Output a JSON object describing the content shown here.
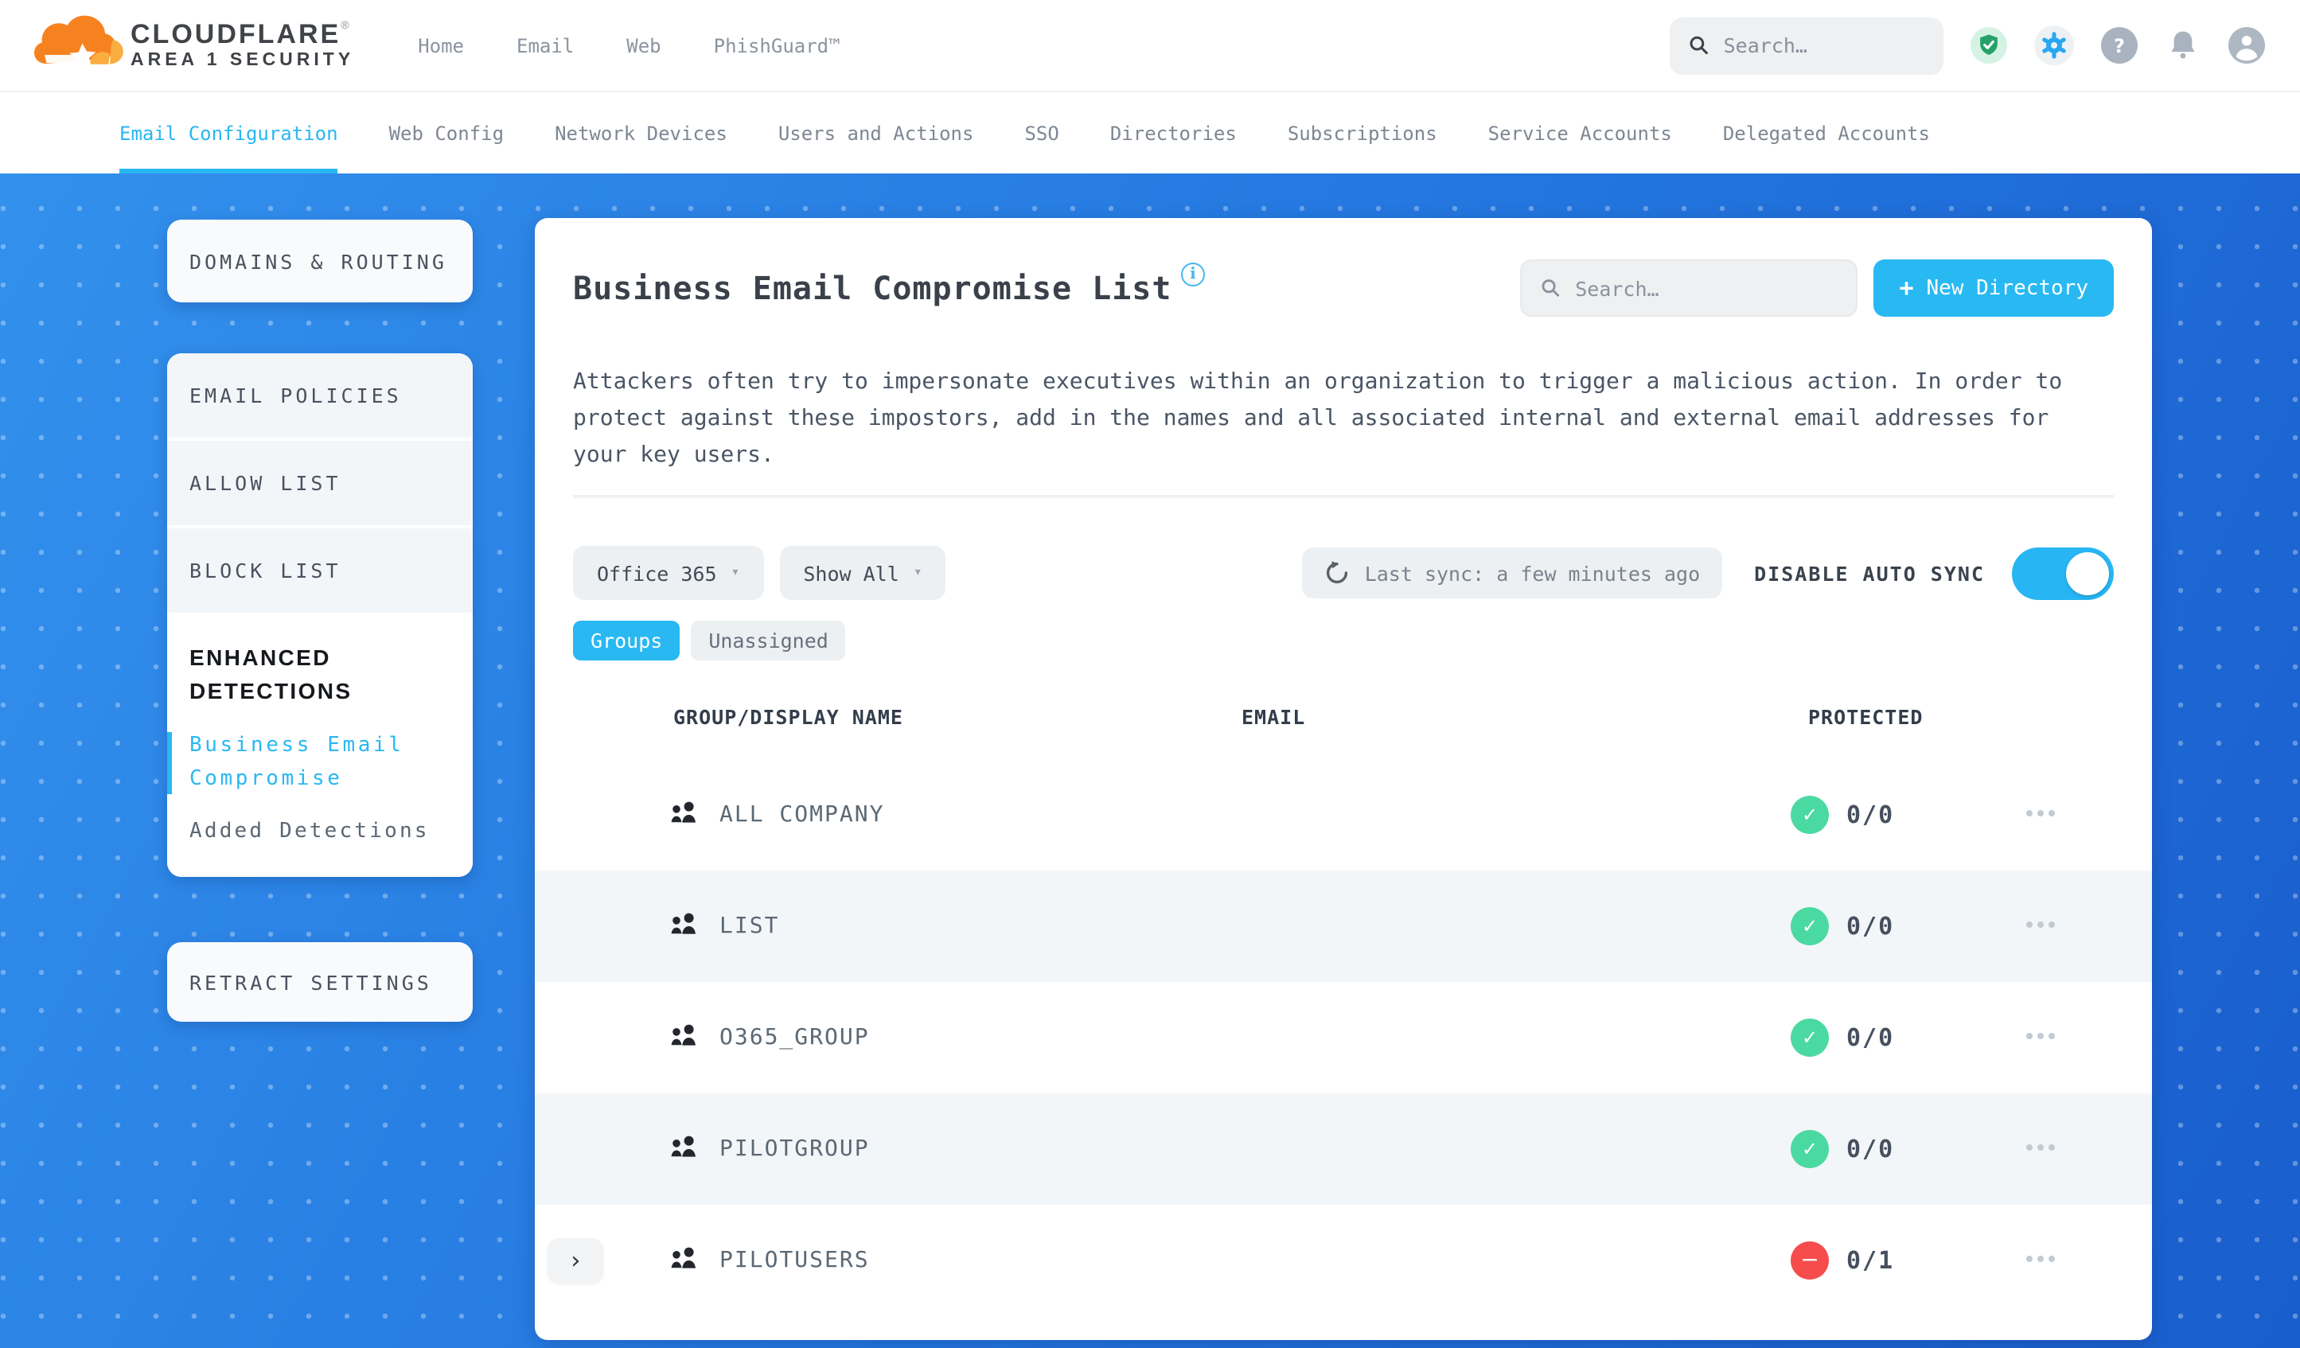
{
  "brand": {
    "name": "CLOUDFLARE",
    "mark": "®",
    "sub": "AREA 1 SECURITY"
  },
  "top_nav": {
    "items": [
      {
        "label": "Home"
      },
      {
        "label": "Email"
      },
      {
        "label": "Web"
      },
      {
        "label": "PhishGuard™"
      }
    ],
    "search_placeholder": "Search…",
    "icons": [
      "shield-check-icon",
      "gear-icon",
      "help-icon",
      "bell-icon",
      "account-icon"
    ]
  },
  "subnav": {
    "items": [
      {
        "label": "Email Configuration",
        "active": true
      },
      {
        "label": "Web Config",
        "active": false
      },
      {
        "label": "Network Devices",
        "active": false
      },
      {
        "label": "Users and Actions",
        "active": false
      },
      {
        "label": "SSO",
        "active": false
      },
      {
        "label": "Directories",
        "active": false
      },
      {
        "label": "Subscriptions",
        "active": false
      },
      {
        "label": "Service Accounts",
        "active": false
      },
      {
        "label": "Delegated Accounts",
        "active": false
      }
    ]
  },
  "sidebar": {
    "domains_routing": "DOMAINS & ROUTING",
    "sections": [
      {
        "label": "EMAIL POLICIES"
      },
      {
        "label": "ALLOW LIST"
      },
      {
        "label": "BLOCK LIST"
      }
    ],
    "enhanced": {
      "title": "ENHANCED DETECTIONS",
      "links": [
        {
          "label": "Business Email Compromise",
          "active": true
        },
        {
          "label": "Added Detections",
          "active": false
        }
      ]
    },
    "retract": "RETRACT SETTINGS"
  },
  "main": {
    "title": "Business Email Compromise List",
    "search_placeholder": "Search…",
    "new_directory_label": "New Directory",
    "description": "Attackers often try to impersonate executives within an organization to trigger a malicious action. In order to protect against these impostors, add in the names and all associated internal and external email addresses for your key users.",
    "filters": {
      "directory": "Office 365",
      "show": "Show All",
      "last_sync": "Last sync: a few minutes ago",
      "auto_sync_label": "DISABLE AUTO SYNC",
      "auto_sync_on": true
    },
    "tabs": [
      {
        "label": "Groups",
        "active": true
      },
      {
        "label": "Unassigned",
        "active": false
      }
    ],
    "table": {
      "columns": [
        "GROUP/DISPLAY NAME",
        "EMAIL",
        "PROTECTED"
      ],
      "rows": [
        {
          "name": "ALL COMPANY",
          "email": "",
          "protected": "0/0",
          "badge_class": "badge badge-green",
          "badge_glyph": "✓",
          "expander_class": "expander ghost"
        },
        {
          "name": "LIST",
          "email": "",
          "protected": "0/0",
          "badge_class": "badge badge-green",
          "badge_glyph": "✓",
          "expander_class": "expander ghost"
        },
        {
          "name": "O365_GROUP",
          "email": "",
          "protected": "0/0",
          "badge_class": "badge badge-green",
          "badge_glyph": "✓",
          "expander_class": "expander ghost"
        },
        {
          "name": "PILOTGROUP",
          "email": "",
          "protected": "0/0",
          "badge_class": "badge badge-green",
          "badge_glyph": "✓",
          "expander_class": "expander ghost"
        },
        {
          "name": "PILOTUSERS",
          "email": "",
          "protected": "0/1",
          "badge_class": "badge badge-red",
          "badge_glyph": "−",
          "expander_class": "expander"
        }
      ]
    }
  },
  "icons": {
    "caret": "▾",
    "plus": "+",
    "expander": "›",
    "question": "?",
    "info": "i"
  },
  "colors": {
    "accent": "#29b8f2",
    "green": "#4bd9a2",
    "red": "#f64c4c",
    "blue_bg": "#2478e0",
    "orange": "#f6821f"
  }
}
